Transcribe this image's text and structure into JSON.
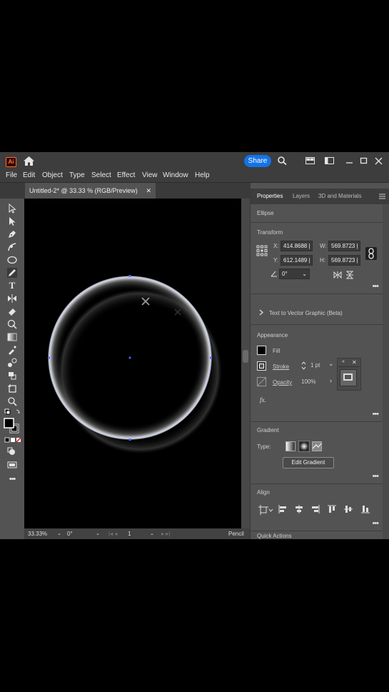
{
  "app": {
    "logo_text": "Ai",
    "share_label": "Share"
  },
  "menu": [
    "File",
    "Edit",
    "Object",
    "Type",
    "Select",
    "Effect",
    "View",
    "Window",
    "Help"
  ],
  "document": {
    "tab_title": "Untitled-2* @ 33.33 % (RGB/Preview)",
    "close": "✕"
  },
  "status": {
    "zoom": "33.33%",
    "rotation": "0°",
    "artboard": "1",
    "tool": "Pencil"
  },
  "properties": {
    "tabs": [
      "Properties",
      "Layers",
      "3D and Materials"
    ],
    "selection": "Ellipse",
    "transform": {
      "heading": "Transform",
      "x_label": "X:",
      "x": "414.8688 |",
      "y_label": "Y:",
      "y": "612.1489 |",
      "w_label": "W:",
      "w": "569.8723 |",
      "h_label": "H:",
      "h": "569.8723 |",
      "angle": "0°"
    },
    "text_to_vector": "Text to Vector Graphic (Beta)",
    "appearance": {
      "heading": "Appearance",
      "fill_label": "Fill",
      "stroke_label": "Stroke",
      "stroke_weight": "1 pt",
      "opacity_label": "Opacity",
      "opacity": "100%",
      "fx": "fx."
    },
    "gradient": {
      "heading": "Gradient",
      "type_label": "Type:",
      "edit_button": "Edit Gradient"
    },
    "align_heading": "Align",
    "quick_actions": "Quick Actions"
  },
  "colors": {
    "accent": "#1473e6",
    "panel": "#535353",
    "chrome": "#3d3d3d",
    "canvas": "#000000"
  }
}
